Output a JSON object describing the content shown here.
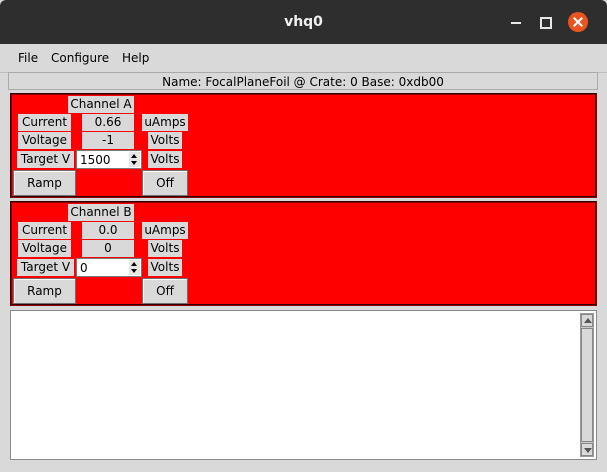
{
  "window": {
    "title": "vhq0"
  },
  "menu": {
    "file": "File",
    "configure": "Configure",
    "help": "Help"
  },
  "header": {
    "text": "Name: FocalPlaneFoil @ Crate: 0 Base: 0xdb00"
  },
  "colors": {
    "panel_bg": "#ff0000",
    "close_button": "#e95420"
  },
  "channels": [
    {
      "title": "Channel A",
      "current_label": "Current",
      "current_value": "0.66",
      "current_unit": "uAmps",
      "voltage_label": "Voltage",
      "voltage_value": "-1",
      "voltage_unit": "Volts",
      "target_label": "Target V",
      "target_value": "1500",
      "target_unit": "Volts",
      "ramp_label": "Ramp",
      "off_label": "Off"
    },
    {
      "title": "Channel B",
      "current_label": "Current",
      "current_value": "0.0",
      "current_unit": "uAmps",
      "voltage_label": "Voltage",
      "voltage_value": "0",
      "voltage_unit": "Volts",
      "target_label": "Target V",
      "target_value": "0",
      "target_unit": "Volts",
      "ramp_label": "Ramp",
      "off_label": "Off"
    }
  ],
  "log": {
    "text": ""
  }
}
